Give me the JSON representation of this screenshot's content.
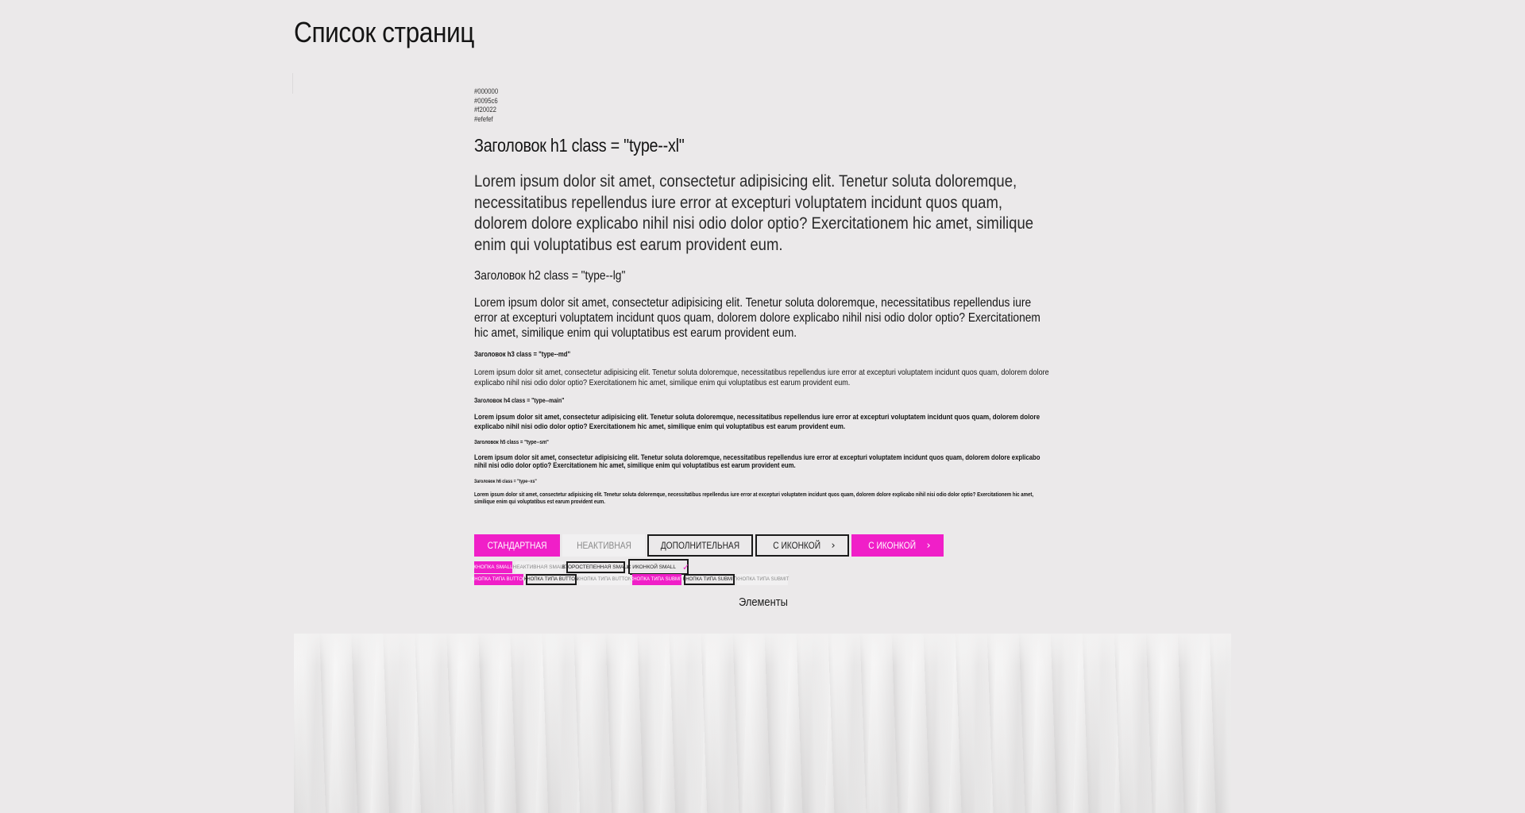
{
  "page": {
    "title": "Список страниц"
  },
  "colors": {
    "swatches": [
      "#000000",
      "#0095c6",
      "#f20022",
      "#efefef"
    ],
    "accent": "#f01fc8",
    "background": "#ebe9ea"
  },
  "typography": {
    "h1": "Заголовок h1 class = \"type--xl\"",
    "p_xl": "Lorem ipsum dolor sit amet, consectetur adipisicing elit. Tenetur soluta doloremque, necessitatibus repellendus iure error at excepturi voluptatem incidunt quos quam, dolorem dolore explicabo nihil nisi odio dolor optio? Exercitationem hic amet, similique enim qui voluptatibus est earum provident eum.",
    "h2": "Заголовок h2 class = \"type--lg\"",
    "p_lg": "Lorem ipsum dolor sit amet, consectetur adipisicing elit. Tenetur soluta doloremque, necessitatibus repellendus iure error at excepturi voluptatem incidunt quos quam, dolorem dolore explicabo nihil nisi odio dolor optio? Exercitationem hic amet, similique enim qui voluptatibus est earum provident eum.",
    "h3": "Заголовок h3 class = \"type--md\"",
    "p_md": "Lorem ipsum dolor sit amet, consectetur adipisicing elit. Tenetur soluta doloremque, necessitatibus repellendus iure error at excepturi voluptatem incidunt quos quam, dolorem dolore explicabo nihil nisi odio dolor optio? Exercitationem hic amet, similique enim qui voluptatibus est earum provident eum.",
    "h4": "Заголовок h4 class = \"type--main\"",
    "p_main": "Lorem ipsum dolor sit amet, consectetur adipisicing elit. Tenetur soluta doloremque, necessitatibus repellendus iure error at excepturi voluptatem incidunt quos quam, dolorem dolore explicabo nihil nisi odio dolor optio? Exercitationem hic amet, similique enim qui voluptatibus est earum provident eum.",
    "h5": "Заголовок h5 class = \"type--sm\"",
    "p_sm": "Lorem ipsum dolor sit amet, consectetur adipisicing elit. Tenetur soluta doloremque, necessitatibus repellendus iure error at excepturi voluptatem incidunt quos quam, dolorem dolore explicabo nihil nisi odio dolor optio? Exercitationem hic amet, similique enim qui voluptatibus est earum provident eum.",
    "h6": "Заголовок h6 class = \"type--xs\"",
    "p_xs": "Lorem ipsum dolor sit amet, consectetur adipisicing elit. Tenetur soluta doloremque, necessitatibus repellendus iure error at excepturi voluptatem incidunt quos quam, dolorem dolore explicabo nihil nisi odio dolor optio? Exercitationem hic amet, similique enim qui voluptatibus est earum provident eum."
  },
  "buttons": {
    "large": {
      "standard": "Стандартная",
      "inactive": "Неактивная",
      "additional": "Дополнительная",
      "with_icon_outline": "С иконкой",
      "with_icon_primary": "С иконкой",
      "chevron_icon": "chevron-right-icon"
    },
    "small": {
      "small_button": "Кнопка small",
      "inactive_small": "Неактивная small",
      "additional_small": "Второстепенная small",
      "with_icon_small": "С иконкой small",
      "check_icon": "check-icon"
    },
    "type_row": {
      "button_1": "Кнопка типа button",
      "button_2": "Кнопка типа button",
      "button_3": "Кнопка типа button",
      "submit_1": "Кнопка типа submit",
      "submit_2": "Кнопка типа submit",
      "submit_3": "Кнопка типа submit"
    }
  },
  "footer_link": {
    "label": "Элементы"
  }
}
